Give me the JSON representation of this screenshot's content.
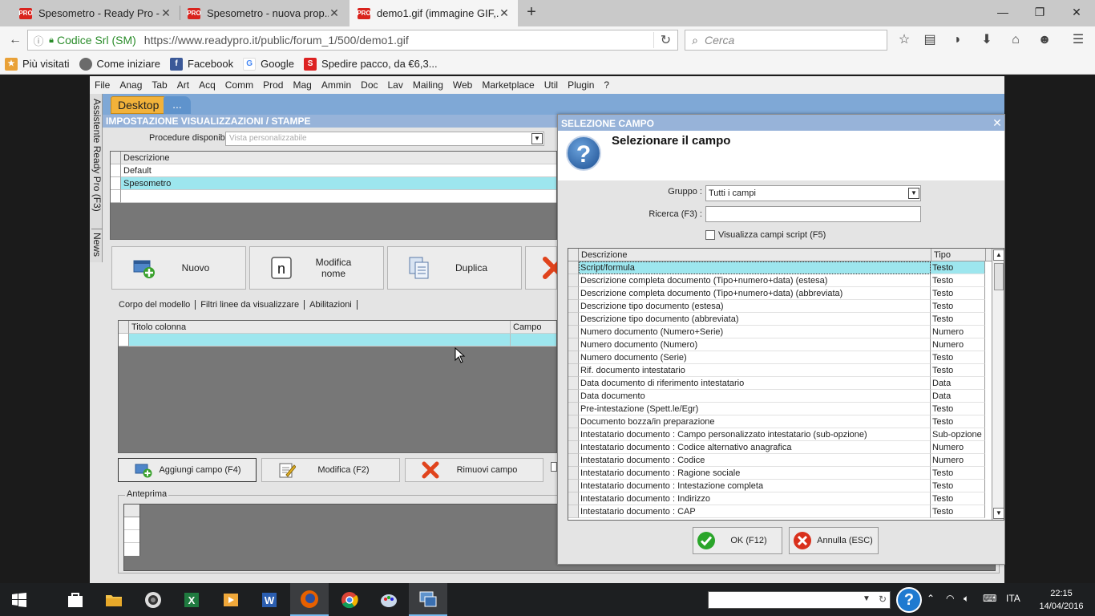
{
  "browser": {
    "tabs": [
      {
        "title": "Spesometro - Ready Pro - ...",
        "favicon": "PRO",
        "active": false
      },
      {
        "title": "Spesometro - nuova prop...",
        "favicon": "PRO",
        "active": false
      },
      {
        "title": "demo1.gif (immagine GIF,...",
        "favicon": "PRO",
        "active": true
      }
    ],
    "url_org": "Codice Srl (SM)",
    "url": "https://www.readypro.it/public/forum_1/500/demo1.gif",
    "search_placeholder": "Cerca",
    "bookmarks": [
      {
        "label": "Più visitati",
        "icon": "bookmark-star-icon"
      },
      {
        "label": "Come iniziare",
        "icon": "firefox-icon"
      },
      {
        "label": "Facebook",
        "icon": "facebook-icon"
      },
      {
        "label": "Google",
        "icon": "google-icon"
      },
      {
        "label": "Spedire pacco, da €6,3...",
        "icon": "shipping-icon"
      }
    ]
  },
  "app": {
    "menu": [
      "File",
      "Anag",
      "Tab",
      "Art",
      "Acq",
      "Comm",
      "Prod",
      "Mag",
      "Ammin",
      "Doc",
      "Lav",
      "Mailing",
      "Web",
      "Marketplace",
      "Util",
      "Plugin",
      "?"
    ],
    "side_tab_1": "Assistente Ready Pro (F3)",
    "side_tab_2": "News",
    "desktop_tab": "Desktop",
    "more_tab": "...",
    "panel_title": "IMPOSTAZIONE VISUALIZZAZIONI / STAMPE",
    "procedures_label": "Procedure disponibili :",
    "procedures_value": "Vista personalizzabile",
    "views_header": "Descrizione",
    "views": [
      "Default",
      "Spesometro"
    ],
    "btn_new": "Nuovo",
    "btn_rename": "Modifica nome",
    "btn_duplicate": "Duplica",
    "subtabs": [
      "Corpo del modello",
      "Filtri linee da visualizzare",
      "Abilitazioni"
    ],
    "col_header_title": "Titolo colonna",
    "col_header_field": "Campo",
    "btn_add_field": "Aggiungi campo (F4)",
    "btn_edit": "Modifica (F2)",
    "btn_remove": "Rimuovi campo",
    "preview_label": "Anteprima"
  },
  "modal": {
    "title": "SELEZIONE CAMPO",
    "heading": "Selezionare il campo",
    "group_label": "Gruppo :",
    "group_value": "Tutti i campi",
    "search_label": "Ricerca (F3) :",
    "search_value": "",
    "script_checkbox_label": "Visualizza campi script (F5)",
    "script_checked": false,
    "col_desc": "Descrizione",
    "col_type": "Tipo",
    "rows": [
      {
        "d": "Script/formula",
        "t": "Testo"
      },
      {
        "d": "Descrizione completa documento (Tipo+numero+data) (estesa)",
        "t": "Testo"
      },
      {
        "d": "Descrizione completa documento (Tipo+numero+data) (abbreviata)",
        "t": "Testo"
      },
      {
        "d": "Descrizione tipo documento (estesa)",
        "t": "Testo"
      },
      {
        "d": "Descrizione tipo documento (abbreviata)",
        "t": "Testo"
      },
      {
        "d": "Numero documento (Numero+Serie)",
        "t": "Numero"
      },
      {
        "d": "Numero documento (Numero)",
        "t": "Numero"
      },
      {
        "d": "Numero documento (Serie)",
        "t": "Testo"
      },
      {
        "d": "Rif. documento intestatario",
        "t": "Testo"
      },
      {
        "d": "Data documento di riferimento intestatario",
        "t": "Data"
      },
      {
        "d": "Data documento",
        "t": "Data"
      },
      {
        "d": "Pre-intestazione (Spett.le/Egr)",
        "t": "Testo"
      },
      {
        "d": "Documento bozza/in preparazione",
        "t": "Testo"
      },
      {
        "d": "Intestatario documento : Campo personalizzato intestatario (sub-opzione)",
        "t": "Sub-opzione"
      },
      {
        "d": "Intestatario documento : Codice alternativo anagrafica",
        "t": "Numero"
      },
      {
        "d": "Intestatario documento : Codice",
        "t": "Numero"
      },
      {
        "d": "Intestatario documento : Ragione sociale",
        "t": "Testo"
      },
      {
        "d": "Intestatario documento : Intestazione completa",
        "t": "Testo"
      },
      {
        "d": "Intestatario documento : Indirizzo",
        "t": "Testo"
      },
      {
        "d": "Intestatario documento : CAP",
        "t": "Testo"
      }
    ],
    "btn_ok": "OK (F12)",
    "btn_cancel": "Annulla (ESC)"
  },
  "taskbar": {
    "language": "ITA",
    "time": "22:15",
    "date": "14/04/2016"
  },
  "colors": {
    "accent_blue": "#97b3d9",
    "selection": "#9de6ee",
    "desktop_tab": "#f2b23a"
  }
}
